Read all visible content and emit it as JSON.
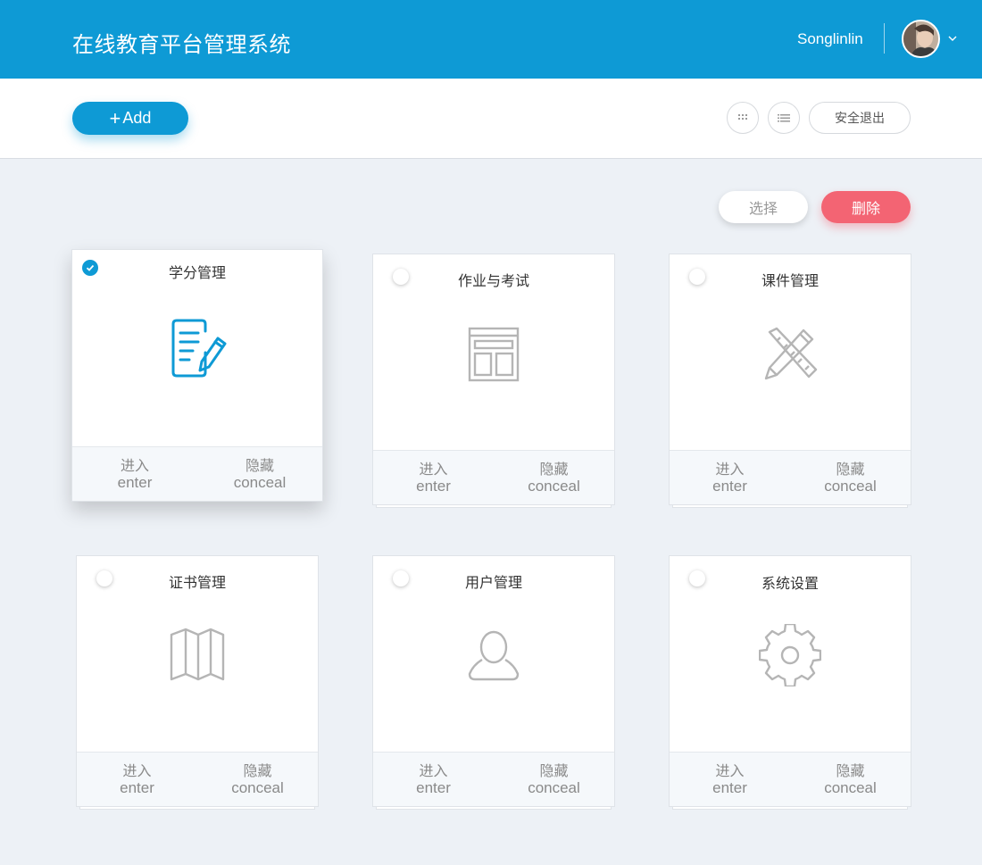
{
  "header": {
    "title": "在线教育平台管理系统",
    "username": "Songlinlin"
  },
  "toolbar": {
    "add_label": "Add",
    "logout_label": "安全退出"
  },
  "actions": {
    "select_label": "选择",
    "delete_label": "删除"
  },
  "cards": [
    {
      "title": "学分管理",
      "checked": true,
      "icon": "edit-document-icon",
      "enter": "进入",
      "enter_en": "enter",
      "conceal": "隐藏",
      "conceal_en": "conceal"
    },
    {
      "title": "作业与考试",
      "checked": false,
      "icon": "layout-icon",
      "enter": "进入",
      "enter_en": "enter",
      "conceal": "隐藏",
      "conceal_en": "conceal"
    },
    {
      "title": "课件管理",
      "checked": false,
      "icon": "ruler-pencil-icon",
      "enter": "进入",
      "enter_en": "enter",
      "conceal": "隐藏",
      "conceal_en": "conceal"
    },
    {
      "title": "证书管理",
      "checked": false,
      "icon": "map-icon",
      "enter": "进入",
      "enter_en": "enter",
      "conceal": "隐藏",
      "conceal_en": "conceal"
    },
    {
      "title": "用户管理",
      "checked": false,
      "icon": "user-icon",
      "enter": "进入",
      "enter_en": "enter",
      "conceal": "隐藏",
      "conceal_en": "conceal"
    },
    {
      "title": "系统设置",
      "checked": false,
      "icon": "gear-icon",
      "enter": "进入",
      "enter_en": "enter",
      "conceal": "隐藏",
      "conceal_en": "conceal"
    }
  ],
  "colors": {
    "primary": "#0e9ad5",
    "danger": "#f36473",
    "icon_inactive": "#b5b5b5",
    "background": "#edf1f6"
  }
}
